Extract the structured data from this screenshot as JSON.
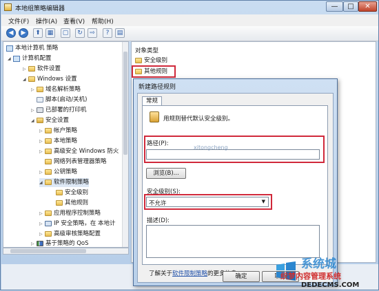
{
  "window": {
    "title": "本地组策略编辑器",
    "controls": [
      "—",
      "□",
      "✕"
    ]
  },
  "menu": [
    {
      "label": "文件(F)"
    },
    {
      "label": "操作(A)"
    },
    {
      "label": "查看(V)"
    },
    {
      "label": "帮助(H)"
    }
  ],
  "toolbar": {
    "back": "◀",
    "forward": "▶",
    "up": "⬆",
    "show_hide_tree": "▦",
    "copy": "▢",
    "refresh": "↻",
    "export": "⇨",
    "help": "?",
    "properties": "▤"
  },
  "tree": {
    "items": [
      {
        "label": "本地计算机 策略",
        "icon": "computer-icon"
      },
      {
        "label": "计算机配置",
        "icon": "computer-icon"
      },
      {
        "label": "软件设置",
        "icon": "folder-icon"
      },
      {
        "label": "Windows 设置",
        "icon": "folder-icon"
      },
      {
        "label": "域名解析策略",
        "icon": "folder-icon"
      },
      {
        "label": "脚本(启动/关机)",
        "icon": "script-icon"
      },
      {
        "label": "已部署的打印机",
        "icon": "printer-icon"
      },
      {
        "label": "安全设置",
        "icon": "shield-icon"
      },
      {
        "label": "帐户策略",
        "icon": "folder-icon"
      },
      {
        "label": "本地策略",
        "icon": "folder-icon"
      },
      {
        "label": "高级安全 Windows 防火",
        "icon": "folder-icon"
      },
      {
        "label": "网络列表管理器策略",
        "icon": "folder-icon"
      },
      {
        "label": "公钥策略",
        "icon": "folder-icon"
      },
      {
        "label": "软件限制策略",
        "icon": "folder-icon"
      },
      {
        "label": "安全级别",
        "icon": "folder-icon"
      },
      {
        "label": "其他规则",
        "icon": "folder-icon"
      },
      {
        "label": "应用程序控制策略",
        "icon": "folder-icon"
      },
      {
        "label": "IP 安全策略，在 本地计",
        "icon": "ipsec-icon"
      },
      {
        "label": "高级审核策略配置",
        "icon": "folder-icon"
      },
      {
        "label": "基于策略的 QoS",
        "icon": "chart-icon"
      }
    ]
  },
  "list": {
    "header": "对象类型",
    "items": [
      {
        "label": "安全级别"
      },
      {
        "label": "其他规则"
      }
    ]
  },
  "dialog": {
    "title": "新建路径规则",
    "tab": "常规",
    "description": "用规则替代默认安全级别。",
    "path_label": "路径(P):",
    "path_value": "",
    "browse_button": "浏览(B)...",
    "security_level_label": "安全级别(S):",
    "security_level_value": "不允许",
    "desc_label": "描述(D):",
    "desc_value": "",
    "learn_prefix": "了解关于",
    "learn_link": "软件限制策略",
    "learn_suffix": "的更多信息",
    "ok_button": "确定",
    "cancel_button": "取消"
  },
  "watermark": {
    "line1": "系统城",
    "line2": "织梦内容管理系统",
    "line3": "DEDECMS.COM",
    "side": "xitongcheng"
  },
  "colors": {
    "highlight": "#d0283a",
    "link": "#1f4fa8"
  }
}
